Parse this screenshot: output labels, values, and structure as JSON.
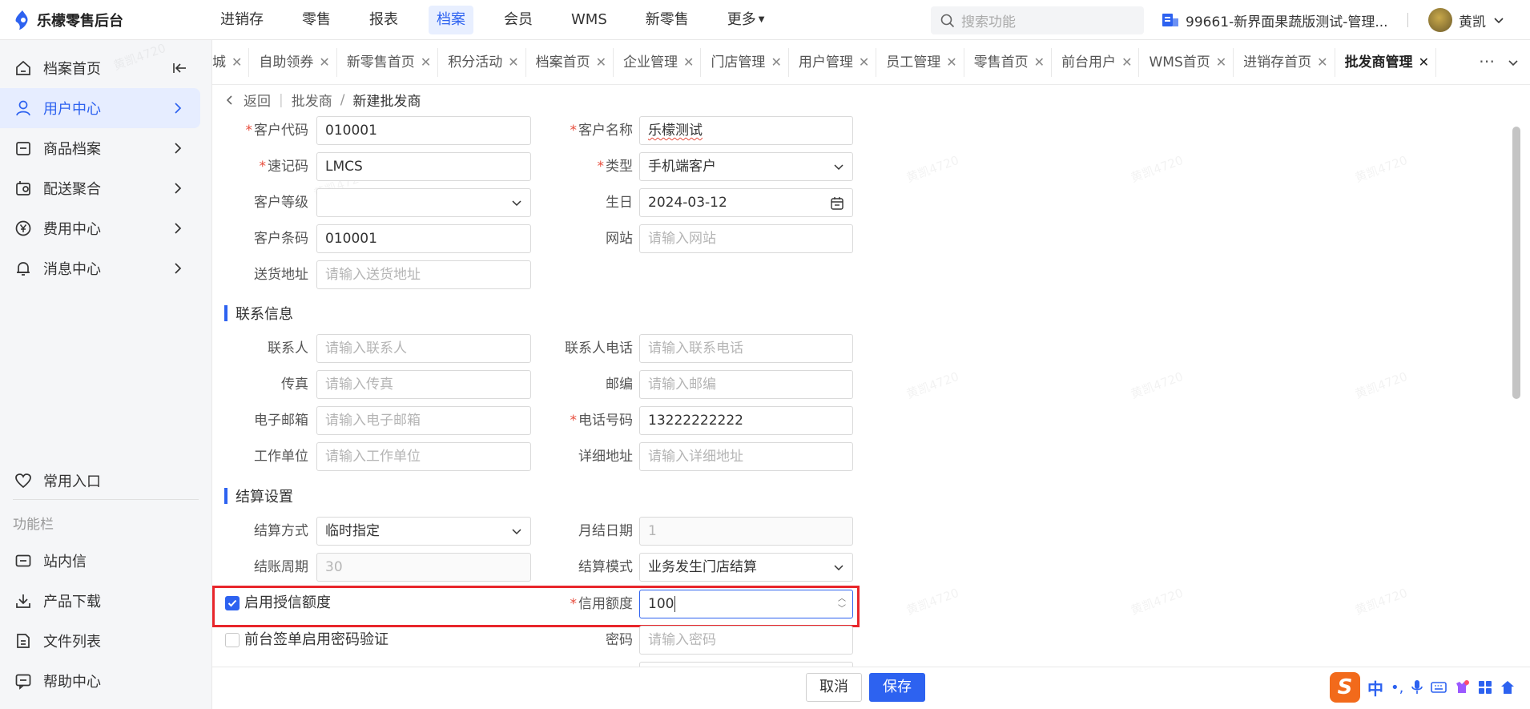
{
  "app": {
    "title": "乐檬零售后台",
    "nav": [
      {
        "label": "进销存",
        "active": false
      },
      {
        "label": "零售",
        "active": false
      },
      {
        "label": "报表",
        "active": false
      },
      {
        "label": "档案",
        "active": true
      },
      {
        "label": "会员",
        "active": false
      },
      {
        "label": "WMS",
        "active": false
      },
      {
        "label": "新零售",
        "active": false
      },
      {
        "label": "更多",
        "active": false
      }
    ],
    "search_placeholder": "搜索功能",
    "store": "99661-新界面果蔬版测试-管理...",
    "user": "黄凯",
    "accent_color": "#2d62f0"
  },
  "sidebar": {
    "items": [
      {
        "label": "档案首页",
        "icon": "home-icon"
      },
      {
        "label": "用户中心",
        "icon": "user-icon",
        "active": true
      },
      {
        "label": "商品档案",
        "icon": "goods-icon"
      },
      {
        "label": "配送聚合",
        "icon": "delivery-icon"
      },
      {
        "label": "费用中心",
        "icon": "yen-icon"
      },
      {
        "label": "消息中心",
        "icon": "bell-icon"
      }
    ],
    "favorites": "常用入口",
    "section": "功能栏",
    "tools": [
      {
        "label": "站内信",
        "icon": "mail-icon"
      },
      {
        "label": "产品下载",
        "icon": "download-icon"
      },
      {
        "label": "文件列表",
        "icon": "file-icon"
      },
      {
        "label": "帮助中心",
        "icon": "help-icon"
      }
    ]
  },
  "tabs": [
    {
      "label": "城"
    },
    {
      "label": "自助领券"
    },
    {
      "label": "新零售首页"
    },
    {
      "label": "积分活动"
    },
    {
      "label": "档案首页"
    },
    {
      "label": "企业管理"
    },
    {
      "label": "门店管理"
    },
    {
      "label": "用户管理"
    },
    {
      "label": "员工管理"
    },
    {
      "label": "零售首页"
    },
    {
      "label": "前台用户"
    },
    {
      "label": "WMS首页"
    },
    {
      "label": "进销存首页"
    },
    {
      "label": "批发商管理",
      "active": true
    }
  ],
  "breadcrumb": {
    "back": "返回",
    "parent": "批发商",
    "current": "新建批发商"
  },
  "form": {
    "customer_code": {
      "label": "客户代码",
      "value": "010001"
    },
    "customer_name": {
      "label": "客户名称",
      "value": "乐檬测试"
    },
    "quick_code": {
      "label": "速记码",
      "value": "LMCS"
    },
    "type": {
      "label": "类型",
      "value": "手机端客户"
    },
    "customer_level": {
      "label": "客户等级",
      "value": ""
    },
    "birthday": {
      "label": "生日",
      "value": "2024-03-12"
    },
    "customer_barcode": {
      "label": "客户条码",
      "value": "010001"
    },
    "website": {
      "label": "网站",
      "placeholder": "请输入网站"
    },
    "delivery_address": {
      "label": "送货地址",
      "placeholder": "请输入送货地址"
    }
  },
  "contact": {
    "title": "联系信息",
    "contact_person": {
      "label": "联系人",
      "placeholder": "请输入联系人"
    },
    "contact_phone": {
      "label": "联系人电话",
      "placeholder": "请输入联系电话"
    },
    "fax": {
      "label": "传真",
      "placeholder": "请输入传真"
    },
    "zip": {
      "label": "邮编",
      "placeholder": "请输入邮编"
    },
    "email": {
      "label": "电子邮箱",
      "placeholder": "请输入电子邮箱"
    },
    "phone": {
      "label": "电话号码",
      "value": "13222222222"
    },
    "work_unit": {
      "label": "工作单位",
      "placeholder": "请输入工作单位"
    },
    "detail_address": {
      "label": "详细地址",
      "placeholder": "请输入详细地址"
    }
  },
  "settlement": {
    "title": "结算设置",
    "method": {
      "label": "结算方式",
      "value": "临时指定"
    },
    "monthly_day": {
      "label": "月结日期",
      "placeholder": "1"
    },
    "period": {
      "label": "结账周期",
      "placeholder": "30"
    },
    "mode": {
      "label": "结算模式",
      "value": "业务发生门店结算"
    },
    "enable_credit": {
      "label": "启用授信额度",
      "checked": true
    },
    "credit_limit": {
      "label": "信用额度",
      "value": "100"
    },
    "password_verify": {
      "label": "前台签单启用密码验证",
      "checked": false
    },
    "password": {
      "label": "密码",
      "placeholder": "请输入密码"
    }
  },
  "footer": {
    "cancel": "取消",
    "save": "保存"
  },
  "ime": {
    "logo": "S",
    "lang": "中"
  },
  "watermark": "黄凯4720"
}
